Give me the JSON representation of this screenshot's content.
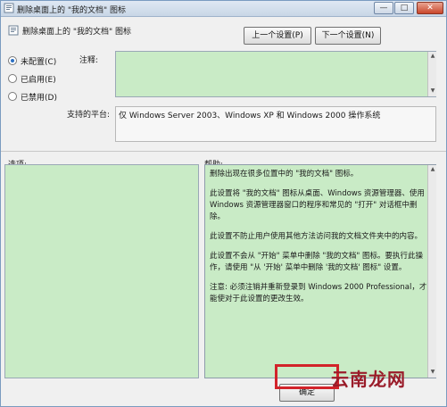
{
  "window": {
    "title": "删除桌面上的 \"我的文档\" 图标",
    "minimize_label": "—",
    "maximize_label": "□",
    "close_label": "✕"
  },
  "header": {
    "title": "删除桌面上的 \"我的文档\" 图标",
    "prev_button": "上一个设置(P)",
    "next_button": "下一个设置(N)"
  },
  "state": {
    "options": [
      {
        "label": "未配置(C)",
        "checked": true
      },
      {
        "label": "已启用(E)",
        "checked": false
      },
      {
        "label": "已禁用(D)",
        "checked": false
      }
    ]
  },
  "comment": {
    "label": "注释:",
    "value": ""
  },
  "platform": {
    "label": "支持的平台:",
    "value": "仅 Windows Server 2003、Windows XP 和 Windows 2000 操作系统"
  },
  "options_section": {
    "label": "选项:"
  },
  "help_section": {
    "label": "帮助:",
    "paragraphs": [
      "删除出现在很多位置中的 \"我的文档\" 图标。",
      "此设置将 \"我的文档\" 图标从桌面、Windows 资源管理器、使用 Windows 资源管理器窗口的程序和常见的 \"打开\" 对话框中删除。",
      "此设置不防止用户使用其他方法访问我的文档文件夹中的内容。",
      "此设置不会从 \"开始\" 菜单中删除 \"我的文档\" 图标。要执行此操作，请使用 \"从 '开始' 菜单中删除 '我的文档' 图标\" 设置。",
      "注意: 必须注销并重新登录到 Windows 2000 Professional，才能使对于此设置的更改生效。"
    ]
  },
  "footer": {
    "ok_button": "确定"
  },
  "watermark": "云南龙网",
  "colors": {
    "panel_green": "#c9ebc6",
    "highlight_red": "#d2232a"
  }
}
